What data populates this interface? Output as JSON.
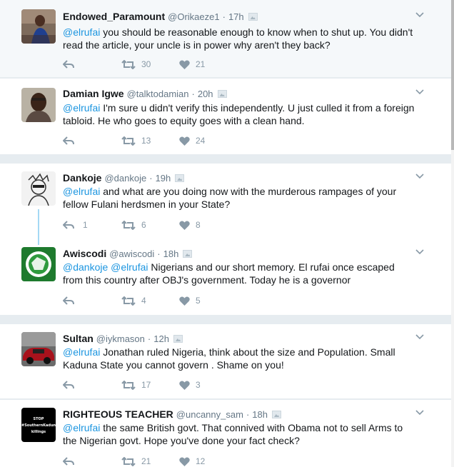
{
  "tweets": [
    {
      "name": "Endowed_Paramount",
      "handle": "@Orikaeze1",
      "time": "17h",
      "mention": "@elrufai",
      "text": " you should be reasonable enough to know when to shut up. You didn't read the article, your uncle is in power why aren't they back?",
      "line1": " you should be reasonable enough to know when to shut up. You didn't",
      "line2": "read the article, your uncle is in power why aren't they back?",
      "retweets": "30",
      "likes": "21",
      "replies": ""
    },
    {
      "name": "Damian Igwe",
      "handle": "@talktodamian",
      "time": "20h",
      "mention": "@elrufai",
      "line1": " I'm sure u didn't verify this independently. U just culled it from a foreign",
      "line2": "tabloid. He who goes to equity goes with a clean hand.",
      "retweets": "13",
      "likes": "24",
      "replies": ""
    },
    {
      "name": "Dankoje",
      "handle": "@dankoje",
      "time": "19h",
      "mention": "@elrufai",
      "line1": " and what are you doing now with the murderous rampages of your",
      "line2": "fellow Fulani herdsmen in your State?",
      "replies": "1",
      "retweets": "6",
      "likes": "8"
    },
    {
      "name": "Awiscodi",
      "handle": "@awiscodi",
      "time": "18h",
      "mention": "@dankoje @elrufai",
      "line1": " Nigerians and our  short memory. El rufai once escaped",
      "line2": "from this country after OBJ's government. Today he is a governor",
      "replies": "",
      "retweets": "4",
      "likes": "5"
    },
    {
      "name": "Sultan",
      "handle": "@iykmason",
      "time": "12h",
      "mention": "@elrufai",
      "line1": " Jonathan ruled Nigeria, think about the size and Population. Small",
      "line2": "Kaduna State you cannot govern . Shame on you!",
      "replies": "",
      "retweets": "17",
      "likes": "3"
    },
    {
      "name": "RIGHTEOUS TEACHER",
      "handle": "@uncanny_sam",
      "time": "18h",
      "mention": "@elrufai",
      "line1": " the same British govt. That connived with Obama not to sell Arms to",
      "line2": "the Nigerian govt. Hope you've done your fact check?",
      "replies": "",
      "retweets": "21",
      "likes": "12"
    }
  ],
  "avatar6_lines": [
    "STOP",
    "#SouthernKaduna",
    "killings"
  ],
  "colors": {
    "link": "#1b95e0",
    "muted": "#657786",
    "icon": "#8899a6",
    "thread": "#a4d9f5"
  },
  "icons": {
    "reply": "reply-icon",
    "retweet": "retweet-icon",
    "like": "heart-icon",
    "more": "chevron-down-icon",
    "media": "image-icon"
  }
}
